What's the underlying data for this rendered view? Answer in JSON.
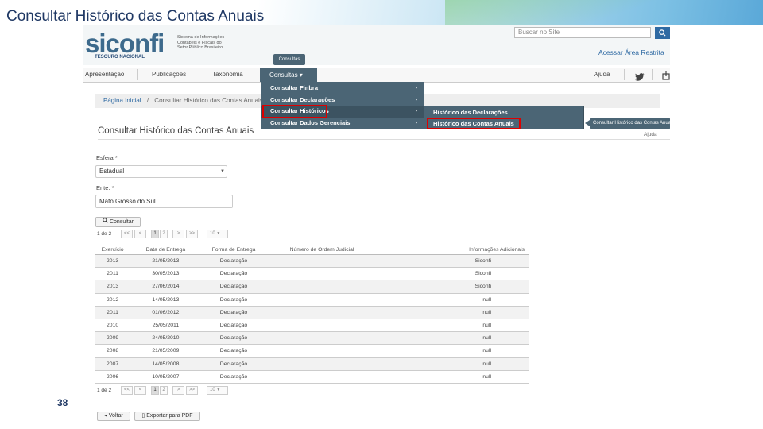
{
  "slide": {
    "title": "Consultar Histórico das Contas Anuais",
    "page_number": "38"
  },
  "header": {
    "logo": "siconfi",
    "logo_subtitle": "Sistema de Informações Contábeis e Fiscais do Setor Público Brasileiro",
    "logo_brand": "TESOURO NACIONAL",
    "search_placeholder": "Buscar no Site",
    "search_icon": "search-icon",
    "restricted_link": "Acessar Área Restrita",
    "tooltip": "Consultas"
  },
  "nav": {
    "items": [
      "Apresentação",
      "Publicações",
      "Taxonomia",
      "Consultas ▾",
      "Ajuda"
    ],
    "icons": [
      "twitter-icon",
      "share-icon"
    ]
  },
  "menu": {
    "level1": [
      "Consultar Finbra",
      "Consultar Declarações",
      "Consultar Históricos",
      "Consultar Dados Gerenciais"
    ],
    "level2": [
      "Histórico das Declarações",
      "Histórico das Contas Anuais"
    ],
    "side_tooltip": "Consultar Histórico das Contas Anuais",
    "arrow": "›"
  },
  "breadcrumb": {
    "home": "Página Inicial",
    "sep": "/",
    "current": "Consultar Histórico das Contas Anuais"
  },
  "page": {
    "title": "Consultar Histórico das Contas Anuais",
    "help": "Ajuda"
  },
  "form": {
    "esfera_label": "Esfera *",
    "esfera_value": "Estadual",
    "ente_label": "Ente: *",
    "ente_value": "Mato Grosso do Sul",
    "consultar_button": "Consultar"
  },
  "pagination": {
    "page_info": "1 de 2",
    "first": "<<",
    "prev": "<",
    "pages": [
      "1",
      "2"
    ],
    "next": ">",
    "last": ">>",
    "page_size": "10"
  },
  "table": {
    "columns": [
      "Exercício",
      "Data de Entrega",
      "Forma de Entrega",
      "Número de Ordem Judicial",
      "Informações Adicionais"
    ],
    "rows": [
      [
        "2013",
        "21/05/2013",
        "Declaração",
        "",
        "Siconfi"
      ],
      [
        "2011",
        "30/05/2013",
        "Declaração",
        "",
        "Siconfi"
      ],
      [
        "2013",
        "27/06/2014",
        "Declaração",
        "",
        "Siconfi"
      ],
      [
        "2012",
        "14/05/2013",
        "Declaração",
        "",
        "null"
      ],
      [
        "2011",
        "01/06/2012",
        "Declaração",
        "",
        "null"
      ],
      [
        "2010",
        "25/05/2011",
        "Declaração",
        "",
        "null"
      ],
      [
        "2009",
        "24/05/2010",
        "Declaração",
        "",
        "null"
      ],
      [
        "2008",
        "21/05/2009",
        "Declaração",
        "",
        "null"
      ],
      [
        "2007",
        "14/05/2008",
        "Declaração",
        "",
        "null"
      ],
      [
        "2006",
        "10/05/2007",
        "Declaração",
        "",
        "null"
      ]
    ]
  },
  "footer_buttons": {
    "back": "◂ Voltar",
    "export": "Exportar para PDF"
  }
}
